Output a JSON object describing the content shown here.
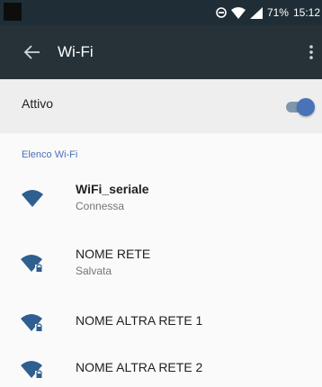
{
  "status_bar": {
    "battery": "71%",
    "time": "15:12",
    "icons": [
      "do-not-disturb-icon",
      "wifi-signal-icon",
      "cell-signal-icon"
    ]
  },
  "toolbar": {
    "title": "Wi-Fi",
    "back_icon": "arrow-back-icon",
    "menu_icon": "overflow-menu-icon"
  },
  "active": {
    "label": "Attivo",
    "toggle_on": true
  },
  "section": {
    "title": "Elenco Wi-Fi"
  },
  "networks": [
    {
      "name": "WiFi_seriale",
      "status": "Connessa",
      "locked": false
    },
    {
      "name": "NOME RETE",
      "status": "Salvata",
      "locked": true
    },
    {
      "name": "NOME ALTRA RETE 1",
      "status": "",
      "locked": true
    },
    {
      "name": "NOME ALTRA RETE 2",
      "status": "",
      "locked": true
    }
  ],
  "colors": {
    "toolbar": "#263238",
    "status_bar": "#1f2e36",
    "accent": "#4a72b8",
    "wifi_icon": "#2f5f8f"
  }
}
